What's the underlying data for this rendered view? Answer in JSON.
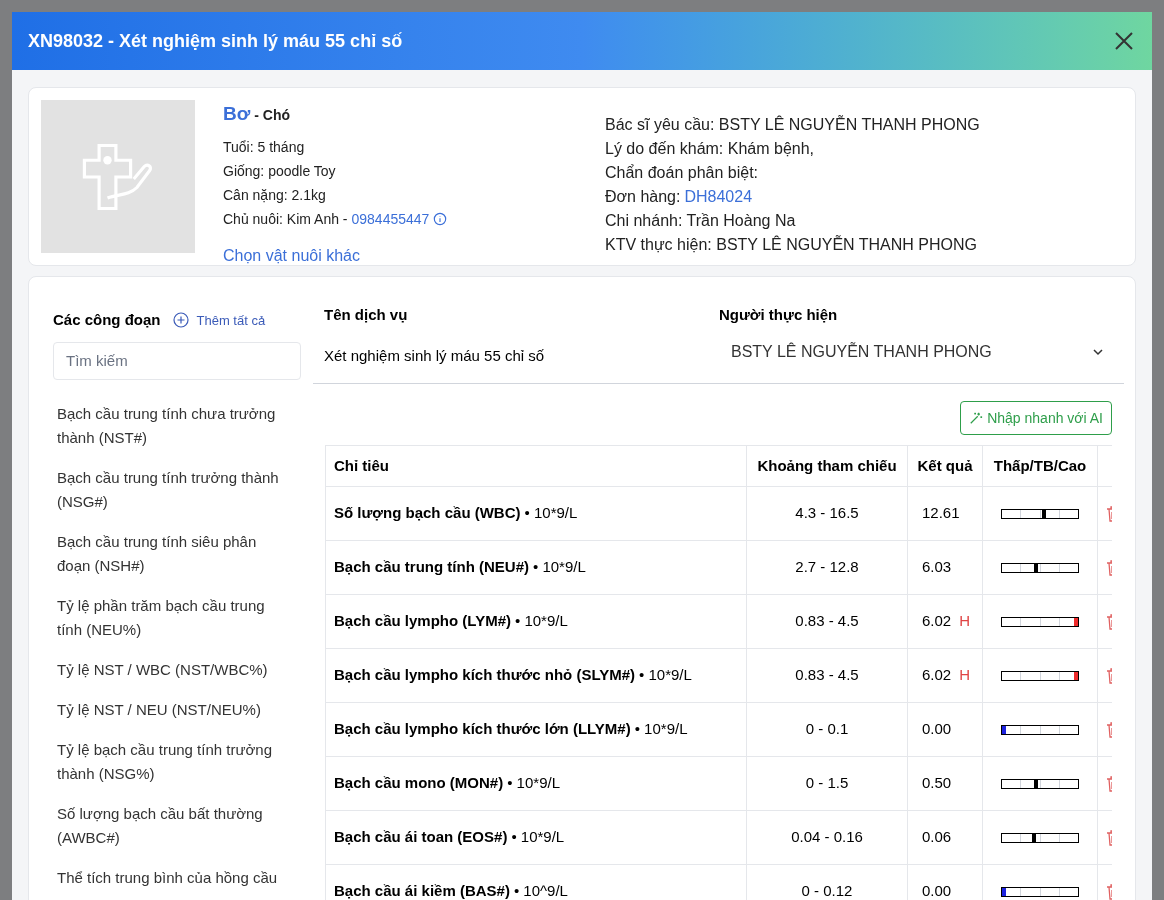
{
  "modal": {
    "title": "XN98032 - Xét nghiệm sinh lý máu 55 chỉ số"
  },
  "pet": {
    "name": "Bơ",
    "species": "- Chó",
    "details": [
      "Tuổi: 5 tháng",
      "Giống: poodle Toy",
      "Cân nặng: 2.1kg"
    ],
    "owner_label": "Chủ nuôi: Kim Anh -",
    "owner_phone": "0984455447",
    "change_link": "Chọn vật nuôi khác"
  },
  "visit": {
    "lines": [
      {
        "label": "Bác sĩ yêu cầu: BSTY LÊ NGUYỄN THANH PHONG"
      },
      {
        "label": "Lý do đến khám: Khám bệnh,"
      },
      {
        "label": "Chẩn đoán phân biệt:"
      },
      {
        "label": "Đơn hàng:",
        "link": "DH84024"
      },
      {
        "label": "Chi nhánh: Trần Hoàng Na"
      },
      {
        "label": "KTV thực hiện: BSTY LÊ NGUYỄN THANH PHONG"
      }
    ]
  },
  "stages": {
    "title": "Các công đoạn",
    "add_all": "Thêm tất cả",
    "search_placeholder": "Tìm kiếm",
    "items": [
      "Bạch cầu trung tính chưa trưởng thành (NST#)",
      "Bạch cầu trung tính trưởng thành (NSG#)",
      "Bạch cầu trung tính siêu phân đoạn (NSH#)",
      "Tỷ lệ phần trăm bạch cầu trung tính (NEU%)",
      "Tỷ lệ NST / WBC (NST/WBC%)",
      "Tỷ lệ NST / NEU (NST/NEU%)",
      "Tỷ lệ bạch cầu trung tính trưởng thành (NSG%)",
      "Số lượng bạch cầu bất thường (AWBC#)",
      "Thể tích trung bình của hồng cầu"
    ]
  },
  "service": {
    "label": "Tên dịch vụ",
    "value": "Xét nghiệm sinh lý máu 55 chỉ số",
    "performer_label": "Người thực hiện",
    "performer": "BSTY LÊ NGUYỄN THANH PHONG"
  },
  "ai_button": "Nhập nhanh với AI",
  "table": {
    "columns": [
      "Chỉ tiêu",
      "Khoảng tham chiếu",
      "Kết quả",
      "Thấp/TB/Cao"
    ],
    "rows": [
      {
        "name": "Số lượng bạch cầu (WBC)",
        "unit": "• 10*9/L",
        "range": "4.3 - 16.5",
        "result": "12.61",
        "kind": "normal",
        "level": 0.55
      },
      {
        "name": "Bạch cầu trung tính (NEU#)",
        "unit": "• 10*9/L",
        "range": "2.7 - 12.8",
        "result": "6.03",
        "kind": "normal",
        "level": 0.45
      },
      {
        "name": "Bạch cầu lympho (LYM#)",
        "unit": "• 10*9/L",
        "range": "0.83 - 4.5",
        "result": "6.02",
        "kind": "high",
        "flag_text": "H",
        "level": 1
      },
      {
        "name": "Bạch cầu lympho kích thước nhỏ (SLYM#)",
        "unit": "• 10*9/L",
        "range": "0.83 - 4.5",
        "result": "6.02",
        "kind": "high",
        "flag_text": "H",
        "level": 1
      },
      {
        "name": "Bạch cầu lympho kích thước lớn (LLYM#)",
        "unit": "• 10*9/L",
        "range": "0 - 0.1",
        "result": "0.00",
        "kind": "low",
        "level": 0
      },
      {
        "name": "Bạch cầu mono (MON#)",
        "unit": "• 10*9/L",
        "range": "0 - 1.5",
        "result": "0.50",
        "kind": "normal",
        "level": 0.45
      },
      {
        "name": "Bạch cầu ái toan (EOS#)",
        "unit": "• 10*9/L",
        "range": "0.04 - 0.16",
        "result": "0.06",
        "kind": "normal",
        "level": 0.42
      },
      {
        "name": "Bạch cầu ái kiềm (BAS#)",
        "unit": "• 10^9/L",
        "range": "0 - 0.12",
        "result": "0.00",
        "kind": "low",
        "level": 0
      }
    ]
  }
}
